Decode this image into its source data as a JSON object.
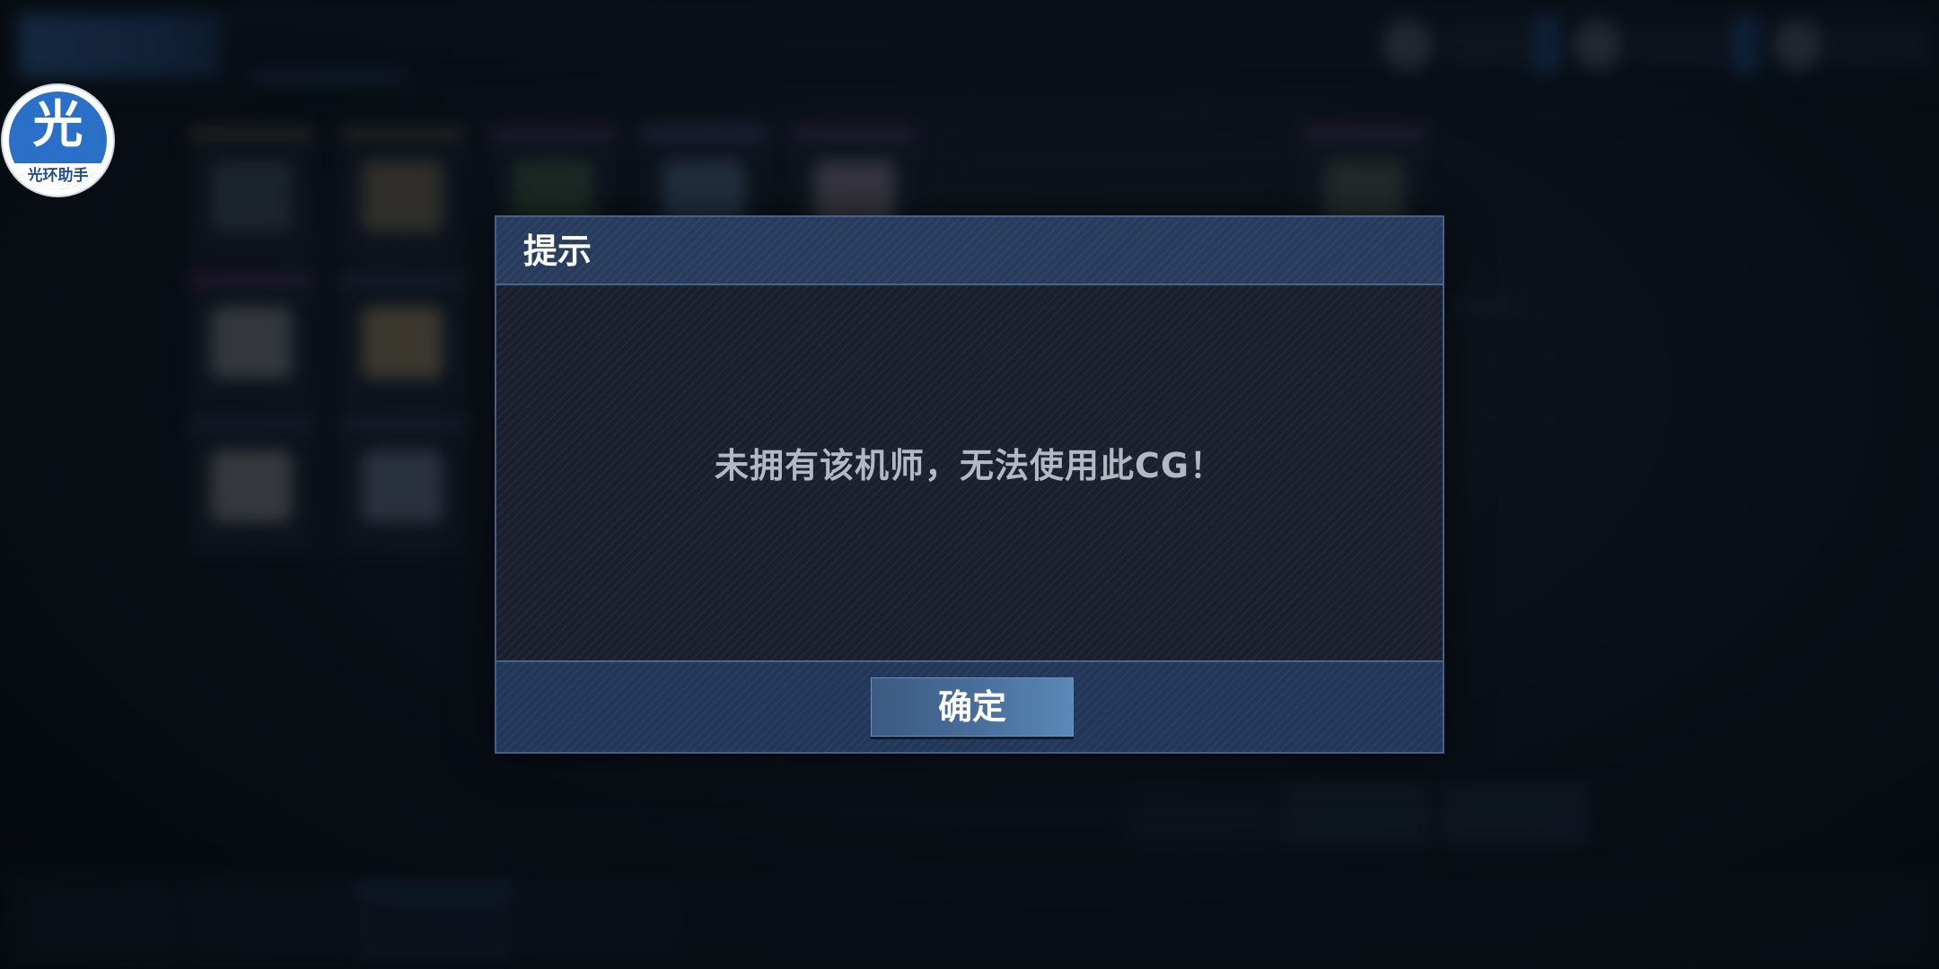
{
  "assistant_badge": {
    "glyph": "光",
    "label": "光环助手"
  },
  "dialog": {
    "title": "提示",
    "message": "未拥有该机师，无法使用此CG！",
    "confirm_label": "确定"
  },
  "colors": {
    "dialog_header": "#273c5c",
    "dialog_body": "#1c1f2d",
    "dialog_footer": "#22375a",
    "confirm_button": "#4a6f9c",
    "badge_blue": "#2a6fc8"
  }
}
